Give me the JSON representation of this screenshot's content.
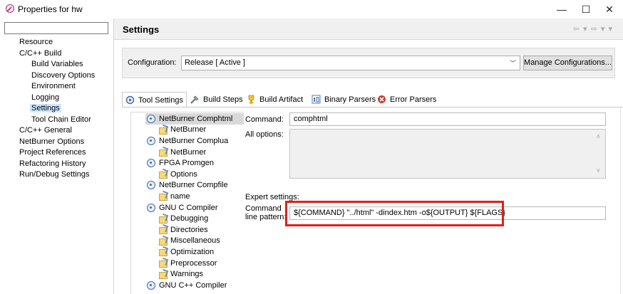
{
  "window": {
    "title": "Properties for hw",
    "controls": {
      "minimize": "—",
      "maximize": "☐",
      "close": "✕"
    }
  },
  "nav": {
    "filter_value": "",
    "items": [
      {
        "label": "Resource",
        "level": 0
      },
      {
        "label": "C/C++ Build",
        "level": 0
      },
      {
        "label": "Build Variables",
        "level": 1
      },
      {
        "label": "Discovery Options",
        "level": 1
      },
      {
        "label": "Environment",
        "level": 1
      },
      {
        "label": "Logging",
        "level": 1
      },
      {
        "label": "Settings",
        "level": 1,
        "selected": true
      },
      {
        "label": "Tool Chain Editor",
        "level": 1
      },
      {
        "label": "C/C++ General",
        "level": 0
      },
      {
        "label": "NetBurner Options",
        "level": 0
      },
      {
        "label": "Project References",
        "level": 0
      },
      {
        "label": "Refactoring History",
        "level": 0
      },
      {
        "label": "Run/Debug Settings",
        "level": 0
      }
    ]
  },
  "header": {
    "title": "Settings",
    "history_nav": "⇦ ▾ ⇨ ▾ ▾"
  },
  "config": {
    "label": "Configuration:",
    "value": "Release  [ Active ]",
    "caret": "﹀",
    "manage_label": "Manage Configurations..."
  },
  "tabs": [
    {
      "label": "Tool Settings",
      "icon": "tool-settings-icon",
      "active": true
    },
    {
      "label": "Build Steps",
      "icon": "build-steps-icon"
    },
    {
      "label": "Build Artifact",
      "icon": "build-artifact-icon"
    },
    {
      "label": "Binary Parsers",
      "icon": "binary-parsers-icon"
    },
    {
      "label": "Error Parsers",
      "icon": "error-parsers-icon"
    }
  ],
  "tool_tree": [
    {
      "label": "NetBurner Comphtml",
      "kind": "tool",
      "selected": true
    },
    {
      "label": "NetBurner",
      "kind": "option"
    },
    {
      "label": "NetBurner Complua",
      "kind": "tool"
    },
    {
      "label": "NetBurner",
      "kind": "option"
    },
    {
      "label": "FPGA Promgen",
      "kind": "tool"
    },
    {
      "label": "Options",
      "kind": "option"
    },
    {
      "label": "NetBurner Compfile",
      "kind": "tool"
    },
    {
      "label": "name",
      "kind": "option"
    },
    {
      "label": "GNU C Compiler",
      "kind": "tool"
    },
    {
      "label": "Debugging",
      "kind": "option"
    },
    {
      "label": "Directories",
      "kind": "option"
    },
    {
      "label": "Miscellaneous",
      "kind": "option"
    },
    {
      "label": "Optimization",
      "kind": "option"
    },
    {
      "label": "Preprocessor",
      "kind": "option"
    },
    {
      "label": "Warnings",
      "kind": "option"
    },
    {
      "label": "GNU C++ Compiler",
      "kind": "tool"
    }
  ],
  "form": {
    "command_label": "Command:",
    "command_value": "comphtml",
    "all_options_label": "All options:",
    "all_options_value": "",
    "expert_label": "Expert settings:",
    "pattern_label_1": "Command",
    "pattern_label_2": "line pattern:",
    "pattern_value": "${COMMAND} \"../html\" -dindex.htm -o${OUTPUT} ${FLAGS}"
  },
  "colors": {
    "highlight": "#e0201c",
    "selection": "#cce8ff"
  }
}
